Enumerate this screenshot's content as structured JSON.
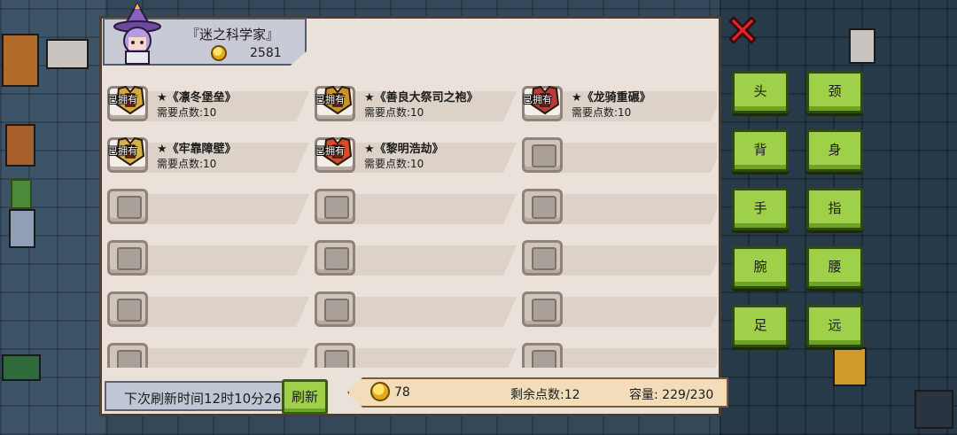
{
  "merchant": {
    "name": "『迷之科学家』",
    "gold": "2581"
  },
  "owned_label": "已拥有",
  "items": [
    {
      "name": "★《凛冬堡垒》",
      "cost": "需要点数:10",
      "owned": true,
      "color": "#d9a93c"
    },
    {
      "name": "★《善良大祭司之袍》",
      "cost": "需要点数:10",
      "owned": true,
      "color": "#c9952a"
    },
    {
      "name": "★《龙骑重碾》",
      "cost": "需要点数:10",
      "owned": true,
      "color": "#b83a3a"
    },
    {
      "name": "★《牢靠障壁》",
      "cost": "需要点数:10",
      "owned": true,
      "color": "#d8b04a"
    },
    {
      "name": "★《黎明浩劫》",
      "cost": "需要点数:10",
      "owned": true,
      "color": "#d94a2a"
    }
  ],
  "empty_slots": 13,
  "footer": {
    "refresh_time": "下次刷新时间12时10分26",
    "refresh_button": "刷新",
    "gold": "78",
    "remaining_points": "剩余点数:12",
    "capacity": "容量:  229/230"
  },
  "categories": [
    "头",
    "颈",
    "背",
    "身",
    "手",
    "指",
    "腕",
    "腰",
    "足",
    "远"
  ],
  "colors": {
    "accent_green": "#9fd04a",
    "close_red": "#e0242a",
    "panel": "#e9e1da"
  }
}
